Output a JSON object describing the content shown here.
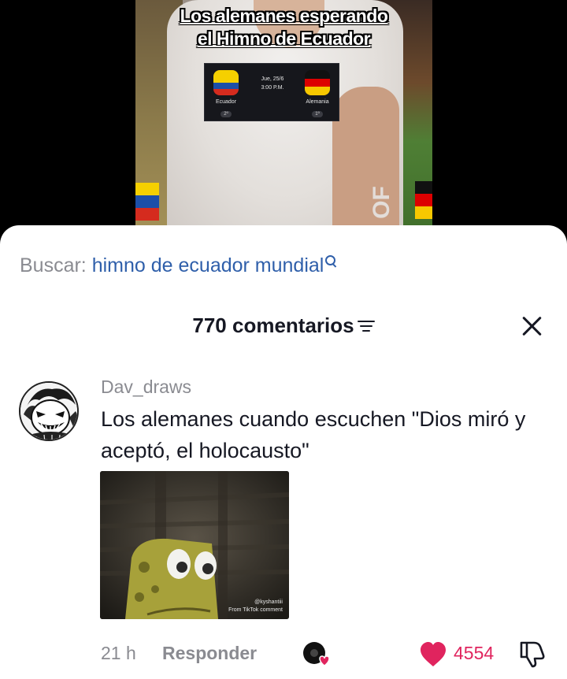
{
  "video": {
    "caption_line1": "Los alemanes esperando",
    "caption_line2": "el Himno de Ecuador",
    "match": {
      "date": "Jue, 25/6",
      "time": "3:00 P.M.",
      "home_team": "Ecuador",
      "home_rank": "2º",
      "away_team": "Alemania",
      "away_rank": "1º"
    },
    "pitch_text": "OF"
  },
  "search": {
    "label": "Buscar:",
    "query": "himno de ecuador mundial",
    "icon": "search-icon"
  },
  "comments_header": {
    "title": "770 comentarios",
    "sort_icon": "sort-icon",
    "close_icon": "close-icon"
  },
  "comment": {
    "username": "Dav_draws",
    "text": "Los alemanes cuando escuchen \"Dios miró y aceptó, el holocausto\"",
    "gif_watermark": "@kyshantiii",
    "gif_source": "From TikTok comment",
    "time": "21 h",
    "reply_label": "Responder",
    "like_count": "4554"
  },
  "colors": {
    "accent_blue": "#2f5faa",
    "like_red": "#e0245e",
    "muted_gray": "#8a8b91",
    "text_dark": "#161823"
  }
}
